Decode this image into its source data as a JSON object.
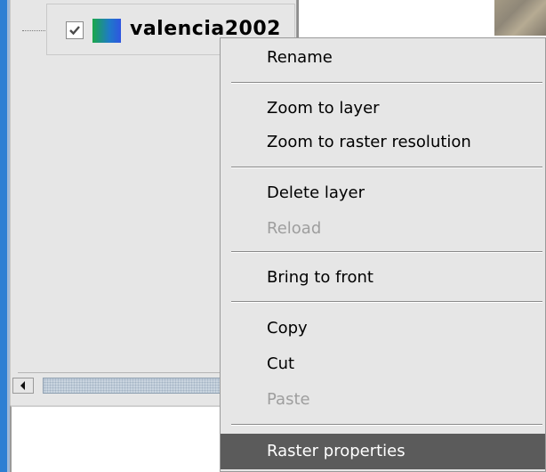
{
  "layer_tree": {
    "layer_name": "valencia2002",
    "checked": true,
    "icon": "raster-layer-icon"
  },
  "context_menu": {
    "items": [
      {
        "label": "Rename",
        "enabled": true
      },
      {
        "label": "Zoom to layer",
        "enabled": true
      },
      {
        "label": "Zoom to raster resolution",
        "enabled": true
      },
      {
        "label": "Delete layer",
        "enabled": true
      },
      {
        "label": "Reload",
        "enabled": false
      },
      {
        "label": "Bring to front",
        "enabled": true
      },
      {
        "label": "Copy",
        "enabled": true
      },
      {
        "label": "Cut",
        "enabled": true
      },
      {
        "label": "Paste",
        "enabled": false
      },
      {
        "label": "Raster properties",
        "enabled": true,
        "highlighted": true
      }
    ]
  },
  "colors": {
    "highlight": "#5b5b5b",
    "disabled_text": "#9e9e9e",
    "panel_background": "#e6e6e6",
    "window_edge": "#2d7fd3"
  },
  "icons": [
    "checkbox-checked-icon",
    "raster-layer-icon",
    "scroll-left-arrow-icon"
  ]
}
